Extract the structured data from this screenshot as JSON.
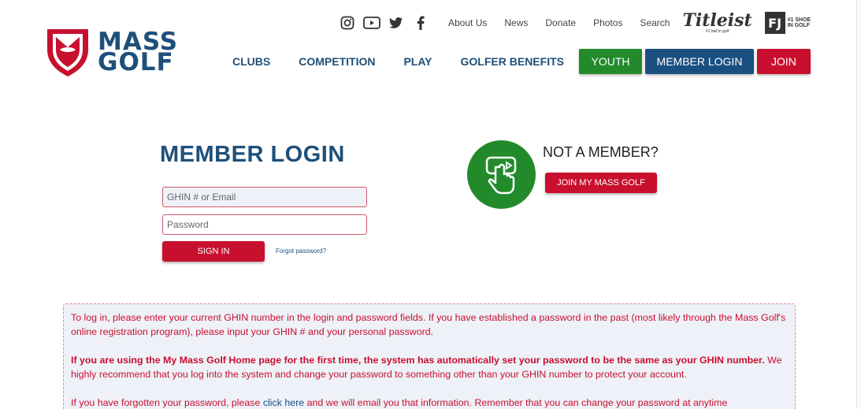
{
  "brand": {
    "name_line1": "MASS",
    "name_line2": "GOLF"
  },
  "social": {
    "icons": [
      "instagram-icon",
      "youtube-icon",
      "twitter-icon",
      "facebook-icon"
    ]
  },
  "util_nav": {
    "about": "About Us",
    "news": "News",
    "donate": "Donate",
    "photos": "Photos",
    "search": "Search"
  },
  "sponsors": {
    "titleist": "Titleist",
    "titleist_tag": "#1 ball in golf",
    "fj": "FJ",
    "fj_line1": "#1 SHOE",
    "fj_line2": "IN GOLF"
  },
  "main_nav": {
    "clubs": "CLUBS",
    "competition": "COMPETITION",
    "play": "PLAY",
    "benefits": "GOLFER BENEFITS",
    "youth": "YOUTH",
    "member_login": "MEMBER LOGIN",
    "join": "JOIN"
  },
  "login": {
    "title": "MEMBER LOGIN",
    "ghin_placeholder": "GHIN # or Email",
    "password_placeholder": "Password",
    "signin": "SIGN IN",
    "forgot": "Forgot password?"
  },
  "not_member": {
    "title": "NOT A MEMBER?",
    "button": "JOIN MY MASS GOLF"
  },
  "info": {
    "p1": "To log in, please enter your current GHIN number in the login and password fields. If you have established a password in the past (most likely through the Mass Golf's online registration program), please input your GHIN # and your personal password.",
    "p2_bold": "If you are using the My Mass Golf Home page for the first time, the system has automatically set your password to be the same as your GHIN number.",
    "p2_rest": "We highly recommend that you log into the system and change your password to something other than your GHIN number to protect your account.",
    "p3_start": "If you have forgotten your password, please",
    "p3_link": "click here",
    "p3_end": "and we will email you that information. Remember that you can change your password at anytime"
  },
  "colors": {
    "navy": "#1e4f7a",
    "red": "#c8102e",
    "green": "#238a2c",
    "info_bg": "#eef1f8"
  }
}
